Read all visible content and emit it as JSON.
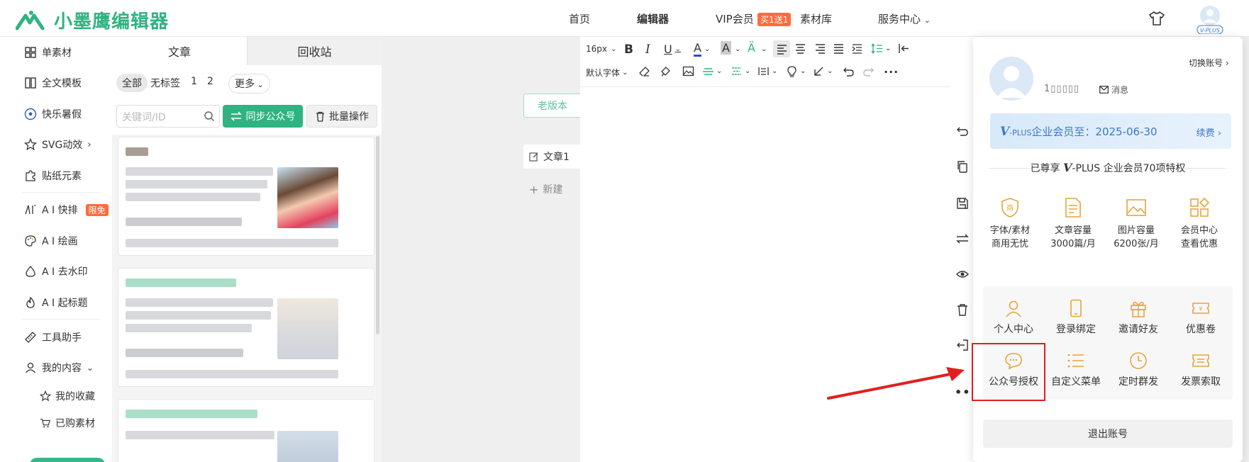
{
  "app": {
    "logo_text": "小墨鹰编辑器"
  },
  "topnav": {
    "home": "首页",
    "editor": "编辑器",
    "vip": "VIP会员",
    "vip_badge": "买1送1",
    "materials": "素材库",
    "service": "服务中心"
  },
  "sidebar": {
    "items": [
      {
        "label": "单素材"
      },
      {
        "label": "全文模板"
      },
      {
        "label": "快乐暑假"
      },
      {
        "label": "SVG动效"
      },
      {
        "label": "贴纸元素"
      },
      {
        "label": "A I 快排",
        "badge": "限免"
      },
      {
        "label": "A I 绘画"
      },
      {
        "label": "A I 去水印"
      },
      {
        "label": "A I 起标题"
      },
      {
        "label": "工具助手"
      },
      {
        "label": "我的内容"
      }
    ],
    "sub_items": [
      {
        "label": "我的收藏"
      },
      {
        "label": "已购素材"
      }
    ]
  },
  "panel": {
    "tabs": [
      "文章",
      "回收站"
    ],
    "filters": [
      "全部",
      "无标签",
      "1",
      "2",
      "更多"
    ],
    "search_placeholder": "关键词/ID",
    "sync_label": "同步公众号",
    "batch_label": "批量操作"
  },
  "canvas": {
    "old_version": "老版本",
    "doc_tab": "文章1",
    "new_tab": "新建"
  },
  "toolbar": {
    "font_size": "16px",
    "font_family": "默认字体"
  },
  "popup": {
    "switch_account": "切换账号",
    "username_masked": "1▯▯▯▯▯",
    "message": "消息",
    "vip_text": "企业会员至：2025-06-30",
    "vip_prefix": "-PLUS",
    "renew": "续费",
    "privilege_title_pre": "已尊享",
    "privilege_title_post": "-PLUS 企业会员70项特权",
    "perks": [
      {
        "line1": "字体/素材",
        "line2": "商用无忧"
      },
      {
        "line1": "文章容量",
        "line2": "3000篇/月"
      },
      {
        "line1": "图片容量",
        "line2": "6200张/月"
      },
      {
        "line1": "会员中心",
        "line2": "查看优惠"
      }
    ],
    "grid": [
      "个人中心",
      "登录绑定",
      "邀请好友",
      "优惠卷",
      "公众号授权",
      "自定义菜单",
      "定时群发",
      "发票索取"
    ],
    "logout": "退出账号"
  },
  "colors": {
    "brand": "#2fb380",
    "gold": "#e8a33d",
    "vip_blue": "#3f78c6",
    "annotation_red": "#e02020"
  }
}
